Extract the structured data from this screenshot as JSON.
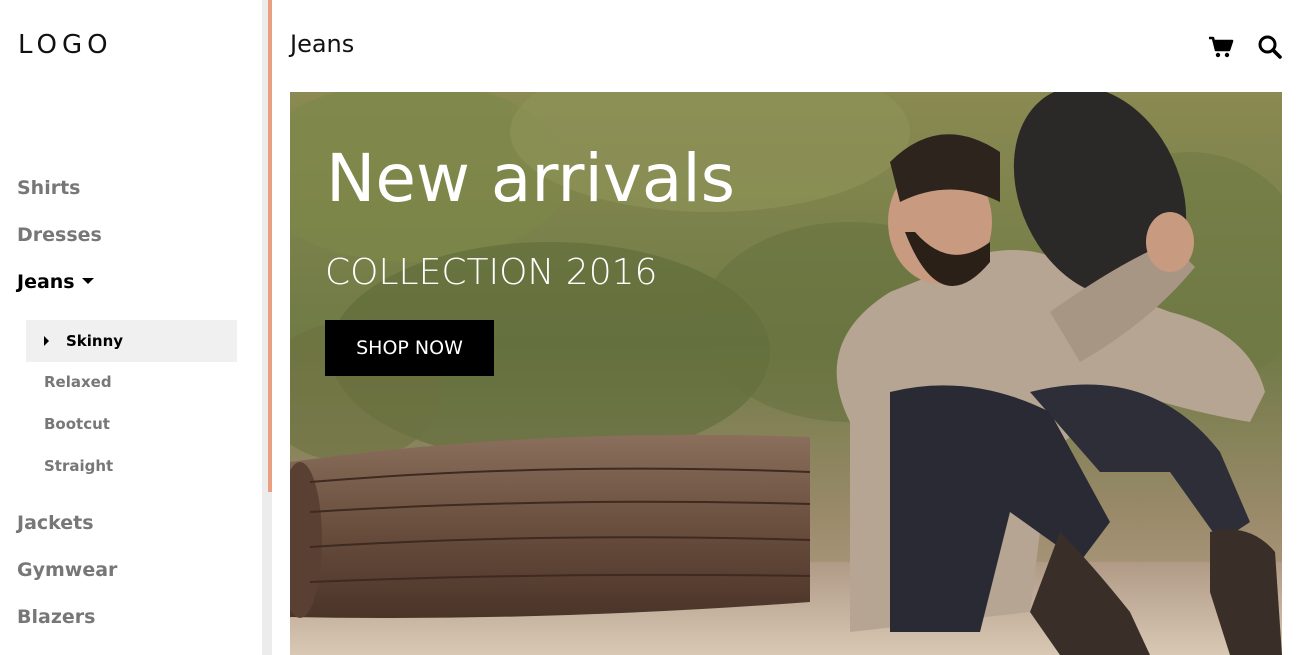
{
  "brand": {
    "logo_text": "LOGO"
  },
  "header": {
    "title": "Jeans",
    "cart_icon": "shopping-cart-icon",
    "search_icon": "search-icon"
  },
  "sidebar": {
    "categories": [
      {
        "label": "Shirts"
      },
      {
        "label": "Dresses"
      },
      {
        "label": "Jeans",
        "expanded": true
      },
      {
        "label": "Jackets"
      },
      {
        "label": "Gymwear"
      },
      {
        "label": "Blazers"
      }
    ],
    "jeans_subitems": [
      {
        "label": "Skinny",
        "active": true
      },
      {
        "label": "Relaxed"
      },
      {
        "label": "Bootcut"
      },
      {
        "label": "Straight"
      }
    ]
  },
  "hero": {
    "title": "New arrivals",
    "subtitle": "COLLECTION 2016",
    "cta_label": "SHOP NOW"
  },
  "colors": {
    "accent_scrollbar": "#e8a080",
    "button_bg": "#000000",
    "active_sub_bg": "#f0f0f0"
  }
}
